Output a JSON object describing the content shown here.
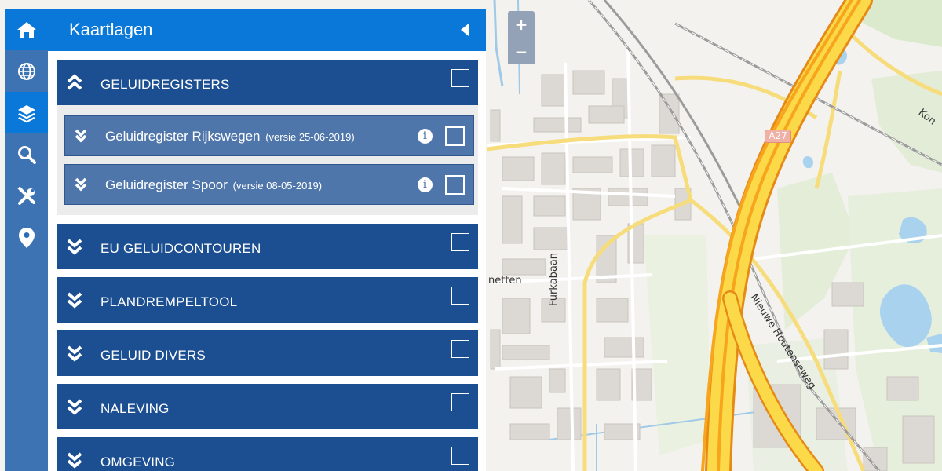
{
  "panel": {
    "title": "Kaartlagen"
  },
  "rail": {
    "items": [
      {
        "icon": "home-icon",
        "active": true
      },
      {
        "icon": "globe-icon",
        "active": false
      },
      {
        "icon": "layers-icon",
        "active": true
      },
      {
        "icon": "search-icon",
        "active": false
      },
      {
        "icon": "tools-icon",
        "active": false
      },
      {
        "icon": "location-pin-icon",
        "active": false
      }
    ]
  },
  "groups": [
    {
      "label": "GELUIDREGISTERS",
      "expanded": true,
      "checked": false,
      "items": [
        {
          "label": "Geluidregister Rijkswegen",
          "version": "(versie 25-06-2019)",
          "info": "i",
          "checked": false
        },
        {
          "label": "Geluidregister Spoor",
          "version": "(versie 08-05-2019)",
          "info": "i",
          "checked": false
        }
      ]
    },
    {
      "label": "EU GELUIDCONTOUREN",
      "expanded": false,
      "checked": false
    },
    {
      "label": "PLANDREMPELTOOL",
      "expanded": false,
      "checked": false
    },
    {
      "label": "GELUID DIVERS",
      "expanded": false,
      "checked": false
    },
    {
      "label": "NALEVING",
      "expanded": false,
      "checked": false
    },
    {
      "label": "OMGEVING",
      "expanded": false,
      "checked": false
    }
  ],
  "map": {
    "zoom_in": "+",
    "zoom_out": "−",
    "labels": {
      "road_shield": "A27",
      "street_furkabaan": "Furkabaan",
      "street_houtenseweg": "Nieuwe Houtenseweg",
      "street_kon": "Kon",
      "place_netten": "netten"
    }
  },
  "colors": {
    "header_blue": "#0a78d9",
    "group_blue": "#1b4f91",
    "subitem_blue": "#4f76ab",
    "highway_orange": "#f7a51c",
    "highway_yellow": "#fbd949"
  }
}
